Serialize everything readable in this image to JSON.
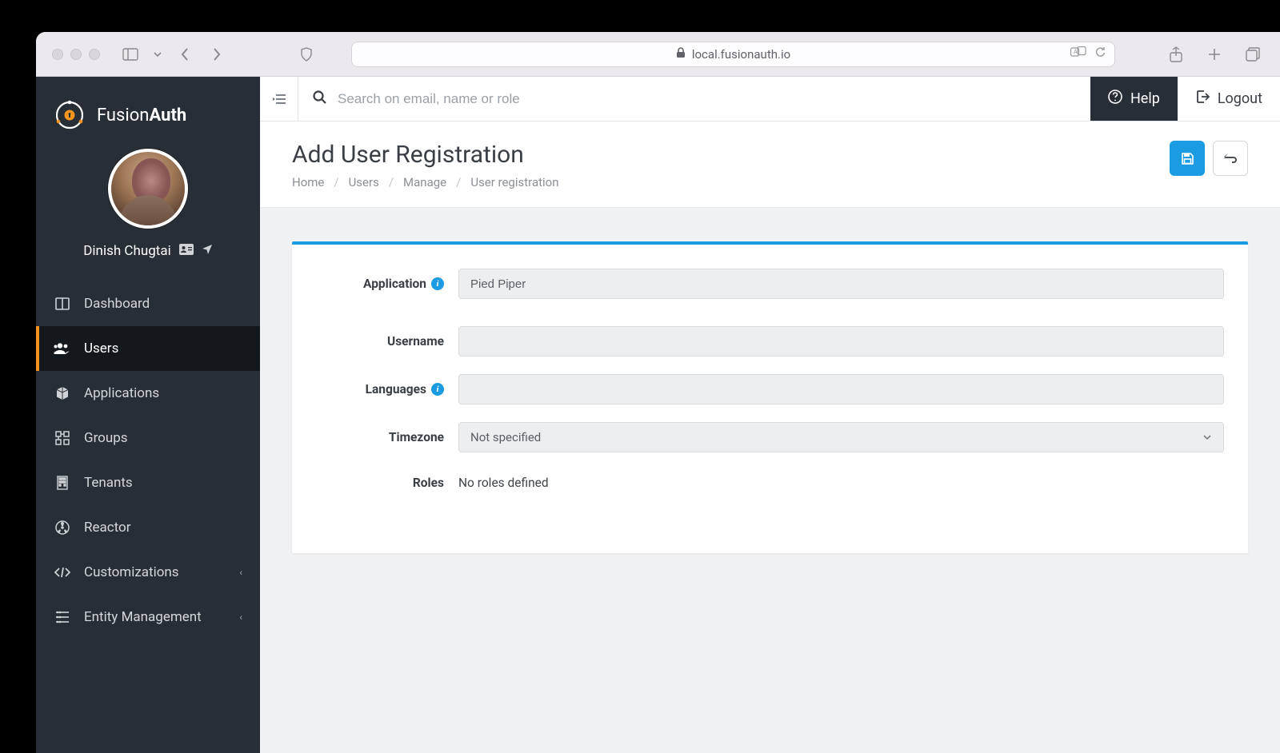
{
  "browser": {
    "url_host": "local.fusionauth.io"
  },
  "brand": {
    "name_a": "Fusion",
    "name_b": "Auth"
  },
  "profile": {
    "name": "Dinish Chugtai"
  },
  "sidebar": {
    "items": [
      {
        "label": "Dashboard",
        "icon": "dashboard",
        "expandable": false
      },
      {
        "label": "Users",
        "icon": "users",
        "expandable": false,
        "active": true
      },
      {
        "label": "Applications",
        "icon": "cube",
        "expandable": false
      },
      {
        "label": "Groups",
        "icon": "groups",
        "expandable": false
      },
      {
        "label": "Tenants",
        "icon": "building",
        "expandable": false
      },
      {
        "label": "Reactor",
        "icon": "reactor",
        "expandable": false
      },
      {
        "label": "Customizations",
        "icon": "code",
        "expandable": true
      },
      {
        "label": "Entity Management",
        "icon": "entity",
        "expandable": true
      }
    ]
  },
  "topbar": {
    "search_placeholder": "Search on email, name or role",
    "help_label": "Help",
    "logout_label": "Logout"
  },
  "page": {
    "title": "Add User Registration",
    "breadcrumb": [
      "Home",
      "Users",
      "Manage",
      "User registration"
    ]
  },
  "form": {
    "application": {
      "label": "Application",
      "value": "Pied Piper",
      "info": true
    },
    "username": {
      "label": "Username",
      "value": ""
    },
    "languages": {
      "label": "Languages",
      "value": "",
      "info": true
    },
    "timezone": {
      "label": "Timezone",
      "value": "Not specified"
    },
    "roles": {
      "label": "Roles",
      "value": "No roles defined"
    }
  }
}
